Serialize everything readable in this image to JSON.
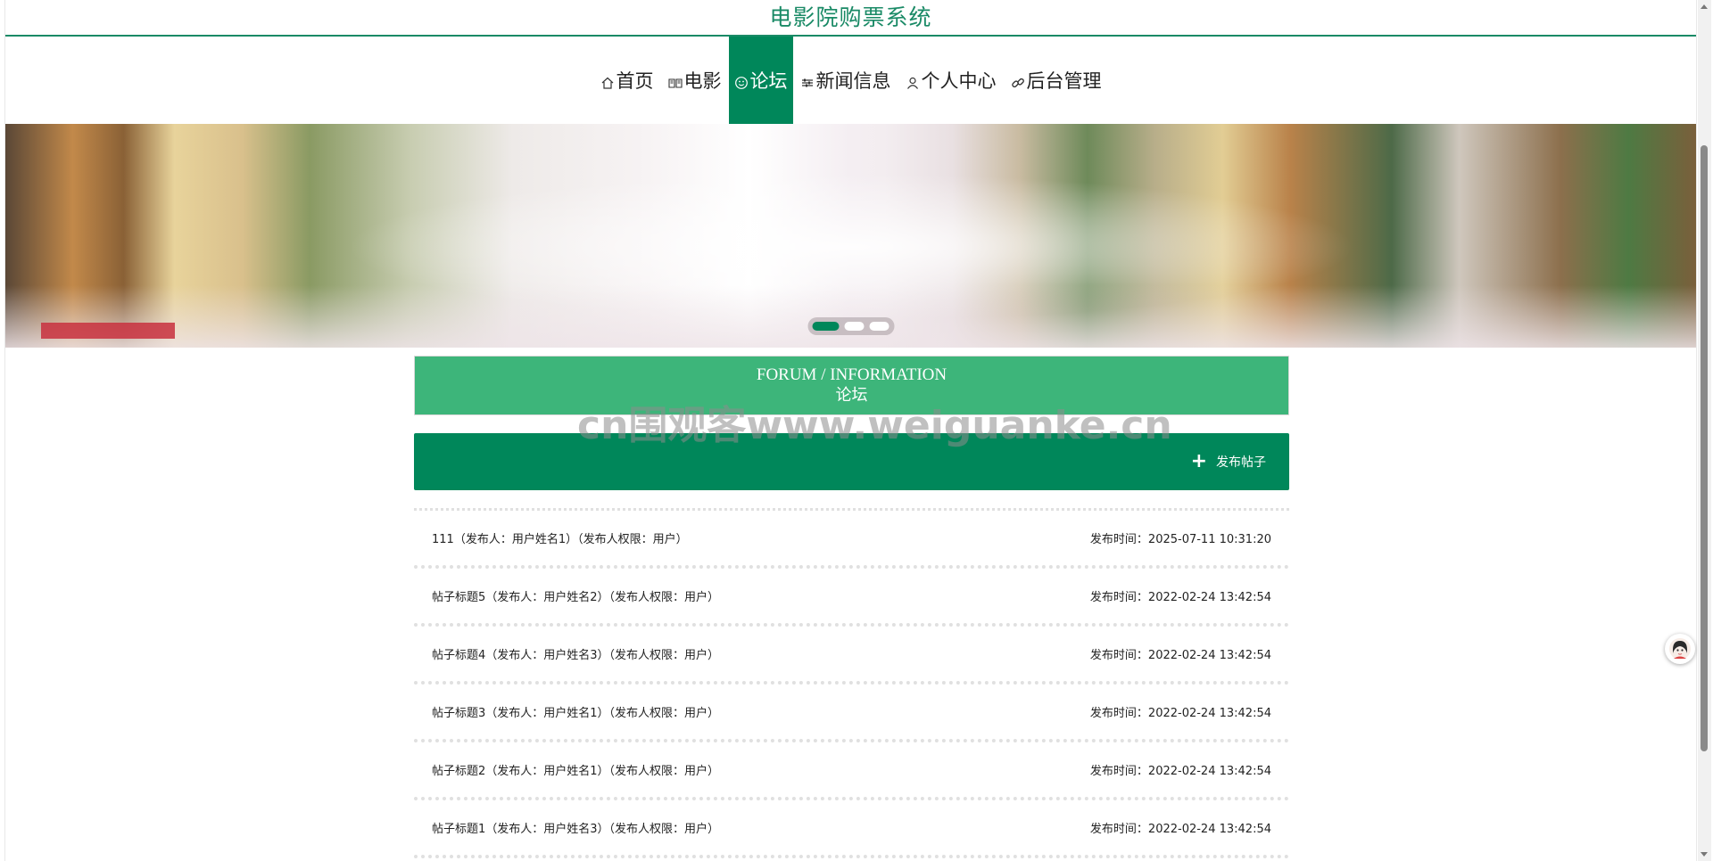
{
  "site": {
    "title": "电影院购票系统"
  },
  "nav": {
    "items": [
      {
        "label": "首页",
        "icon": "home-icon",
        "active": false
      },
      {
        "label": "电影",
        "icon": "book-icon",
        "active": false
      },
      {
        "label": "论坛",
        "icon": "smile-icon",
        "active": true
      },
      {
        "label": "新闻信息",
        "icon": "sliders-icon",
        "active": false
      },
      {
        "label": "个人中心",
        "icon": "user-icon",
        "active": false
      },
      {
        "label": "后台管理",
        "icon": "link-icon",
        "active": false
      }
    ]
  },
  "banner": {
    "slides_count": 3,
    "active_slide": 1
  },
  "section": {
    "title_en": "FORUM / INFORMATION",
    "title_zh": "论坛"
  },
  "watermark": {
    "text": "cn围观客www.weiguanke.cn"
  },
  "actions": {
    "post_label": "发布帖子"
  },
  "posts": [
    {
      "text": "111（发布人：用户姓名1）（发布人权限：用户）",
      "time": "发布时间：2025-07-11 10:31:20"
    },
    {
      "text": "帖子标题5（发布人：用户姓名2）（发布人权限：用户）",
      "time": "发布时间：2022-02-24 13:42:54"
    },
    {
      "text": "帖子标题4（发布人：用户姓名3）（发布人权限：用户）",
      "time": "发布时间：2022-02-24 13:42:54"
    },
    {
      "text": "帖子标题3（发布人：用户姓名1）（发布人权限：用户）",
      "time": "发布时间：2022-02-24 13:42:54"
    },
    {
      "text": "帖子标题2（发布人：用户姓名1）（发布人权限：用户）",
      "time": "发布时间：2022-02-24 13:42:54"
    },
    {
      "text": "帖子标题1（发布人：用户姓名3）（发布人权限：用户）",
      "time": "发布时间：2022-02-24 13:42:54"
    }
  ],
  "colors": {
    "brand_green": "#00875a",
    "header_green": "#3db57a",
    "title_green": "#1a8a66"
  }
}
